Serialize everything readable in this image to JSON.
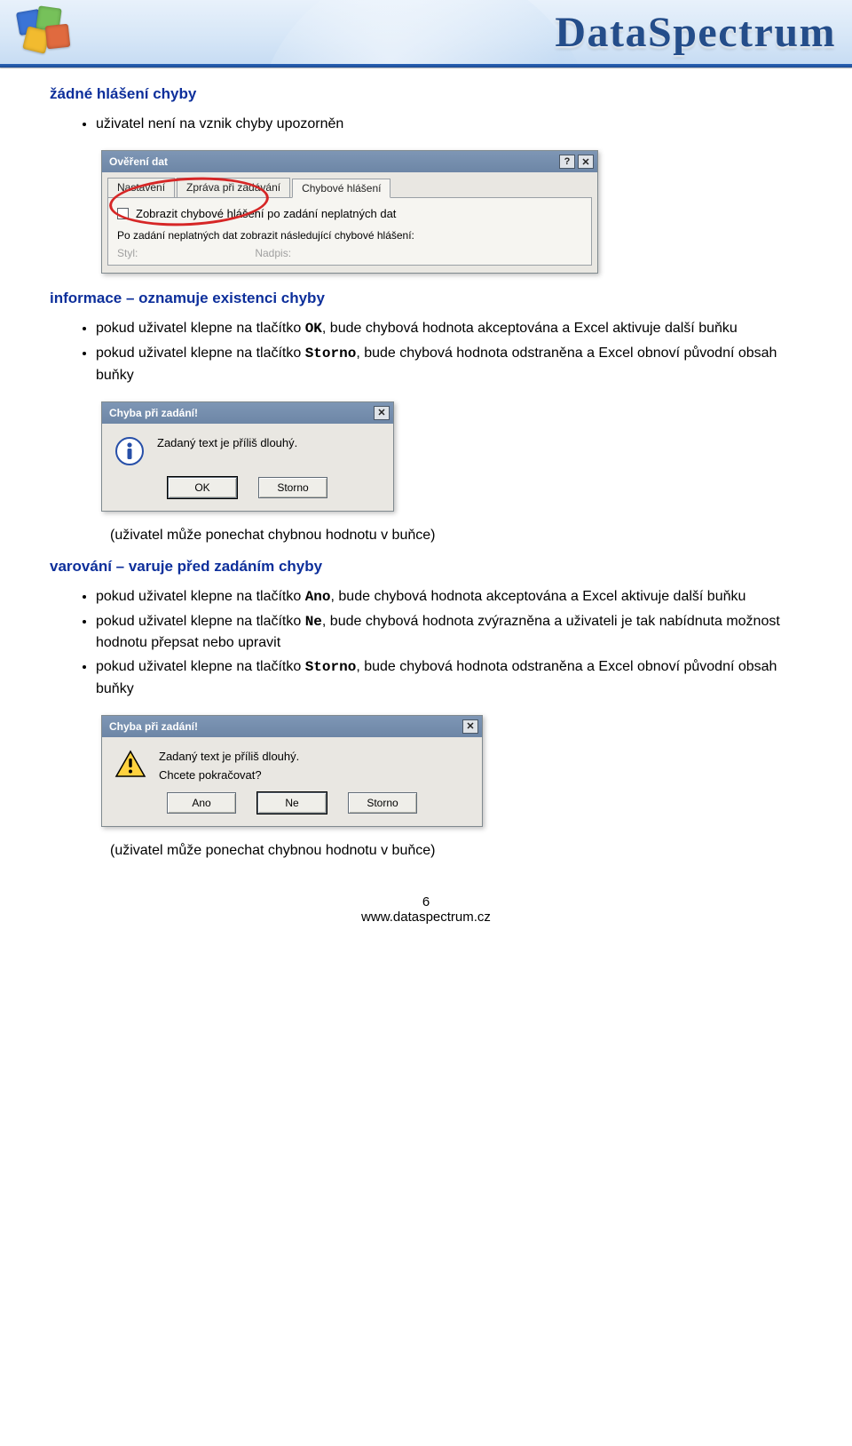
{
  "header": {
    "brand": "DataSpectrum"
  },
  "section1": {
    "heading": "žádné hlášení chyby",
    "bullet1": "uživatel není na vznik chyby upozorněn"
  },
  "dialog_validation": {
    "title": "Ověření dat",
    "tabs": {
      "t1": "Nastavení",
      "t2": "Zpráva při zadávání",
      "t3": "Chybové hlášení"
    },
    "checkbox_label": "Zobrazit chybové hlášení po zadání neplatných dat",
    "subtext": "Po zadání neplatných dat zobrazit následující chybové hlášení:",
    "grey1": "Styl:",
    "grey2": "Nadpis:"
  },
  "section2": {
    "heading": "informace – oznamuje existenci chyby",
    "b1_pre": "pokud uživatel klepne na tlačítko ",
    "b1_kw": "OK",
    "b1_post": ", bude chybová hodnota akceptována a Excel aktivuje další buňku",
    "b2_pre": "pokud uživatel klepne na tlačítko ",
    "b2_kw": "Storno",
    "b2_post": ", bude chybová hodnota odstraněna  a Excel obnoví původní obsah buňky"
  },
  "dialog_info": {
    "title": "Chyba při zadání!",
    "msg": "Zadaný text je příliš dlouhý.",
    "btn_ok": "OK",
    "btn_cancel": "Storno"
  },
  "note1": "(uživatel může ponechat chybnou hodnotu v buňce)",
  "section3": {
    "heading": "varování – varuje před zadáním chyby",
    "b1_pre": "pokud uživatel klepne na tlačítko ",
    "b1_kw": "Ano",
    "b1_post": ", bude chybová hodnota akceptována a Excel aktivuje další buňku",
    "b2_pre": "pokud uživatel klepne na tlačítko ",
    "b2_kw": "Ne",
    "b2_post": ", bude chybová hodnota zvýrazněna a uživateli je tak nabídnuta možnost hodnotu přepsat nebo upravit",
    "b3_pre": "pokud uživatel klepne na tlačítko ",
    "b3_kw": "Storno",
    "b3_post": ", bude chybová hodnota odstraněna  a Excel obnoví původní obsah buňky"
  },
  "dialog_warn": {
    "title": "Chyba při zadání!",
    "msg1": "Zadaný text je příliš dlouhý.",
    "msg2": "Chcete pokračovat?",
    "btn_yes": "Ano",
    "btn_no": "Ne",
    "btn_cancel": "Storno"
  },
  "note2": "(uživatel může ponechat chybnou hodnotu v buňce)",
  "footer": {
    "page": "6",
    "url": "www.dataspectrum.cz"
  }
}
